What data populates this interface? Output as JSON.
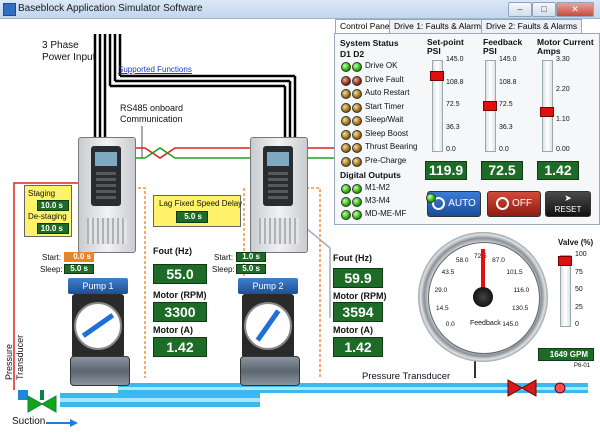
{
  "window": {
    "title": "Baseblock Application Simulator Software",
    "min": "–",
    "max": "□",
    "close": "✕"
  },
  "tabs": [
    "Control Panel",
    "Drive 1: Faults & Alarms",
    "Drive 2: Faults & Alarms"
  ],
  "diagram": {
    "power_input": "3 Phase\nPower Input",
    "supported_functions_link": "Supported Functions",
    "rs485": "RS485 onboard\nCommunication",
    "pressure_transducer_left": "Pressure\nTransducer",
    "pressure_transducer_bottom": "Pressure Transducer",
    "suction": "Suction",
    "feedback_label": "Feedback",
    "flow_gpm": "1649 GPM",
    "pipe_tag": "P6-01"
  },
  "staging": {
    "staging_label": "Staging",
    "staging_value": "10.0 s",
    "destaging_label": "De-staging",
    "destaging_value": "10.0 s"
  },
  "lag_delay": {
    "label": "Lag Fixed Speed Delay",
    "value": "5.0 s"
  },
  "pump1": {
    "label": "Pump 1",
    "start_label": "Start:",
    "start_value": "0.0 s",
    "sleep_label": "Sleep:",
    "sleep_value": "5.0 s",
    "fout_label": "Fout (Hz)",
    "fout": "55.0",
    "rpm_label": "Motor (RPM)",
    "rpm": "3300",
    "amps_label": "Motor (A)",
    "amps": "1.42"
  },
  "pump2": {
    "label": "Pump 2",
    "start_label": "Start:",
    "start_value": "1.0 s",
    "sleep_label": "Sleep:",
    "sleep_value": "5.0 s",
    "fout_label": "Fout (Hz)",
    "fout": "59.9",
    "rpm_label": "Motor (RPM)",
    "rpm": "3594",
    "amps_label": "Motor (A)",
    "amps": "1.42"
  },
  "system_status": {
    "header": "System Status",
    "cols": "D1  D2",
    "items": [
      {
        "label": "Drive OK",
        "d1": "green",
        "d2": "green"
      },
      {
        "label": "Drive Fault",
        "d1": "red",
        "d2": "red"
      },
      {
        "label": "Auto Restart",
        "d1": "orange",
        "d2": "orange"
      },
      {
        "label": "Start Timer",
        "d1": "orange",
        "d2": "orange"
      },
      {
        "label": "Sleep/Wait",
        "d1": "orange",
        "d2": "orange"
      },
      {
        "label": "Sleep Boost",
        "d1": "orange",
        "d2": "orange"
      },
      {
        "label": "Thrust Bearing",
        "d1": "orange",
        "d2": "orange"
      },
      {
        "label": "Pre-Charge",
        "d1": "orange",
        "d2": "orange"
      }
    ]
  },
  "digital_outputs": {
    "header": "Digital Outputs",
    "items": [
      {
        "label": "M1-M2",
        "d1": "green",
        "d2": "green"
      },
      {
        "label": "M3-M4",
        "d1": "green",
        "d2": "green"
      },
      {
        "label": "MD-ME-MF",
        "d1": "green",
        "d2": "green"
      }
    ]
  },
  "setpoint": {
    "header": "Set-point\nPSI",
    "ticks": [
      "145.0",
      "108.8",
      "72.5",
      "36.3",
      "0.0"
    ],
    "value": "119.9",
    "level": 0.83
  },
  "feedback": {
    "header": "Feedback\nPSI",
    "ticks": [
      "145.0",
      "108.8",
      "72.5",
      "36.3",
      "0.0"
    ],
    "value": "72.5",
    "level": 0.5
  },
  "motor_current": {
    "header": "Motor Current\nAmps",
    "ticks": [
      "3.30",
      "2.20",
      "1.10",
      "0.00"
    ],
    "value": "1.42",
    "level": 0.43
  },
  "buttons": {
    "auto": "AUTO",
    "off": "OFF",
    "reset": "RESET"
  },
  "gauge": {
    "ticks": [
      "0.0",
      "14.5",
      "29.0",
      "43.5",
      "58.0",
      "72.5",
      "87.0",
      "101.5",
      "116.0",
      "130.5",
      "145.0"
    ],
    "value": 72.5,
    "max": 145
  },
  "valve": {
    "label": "Valve (%)",
    "ticks": [
      "100",
      "75",
      "50",
      "25",
      "0"
    ],
    "level": 0.93
  }
}
